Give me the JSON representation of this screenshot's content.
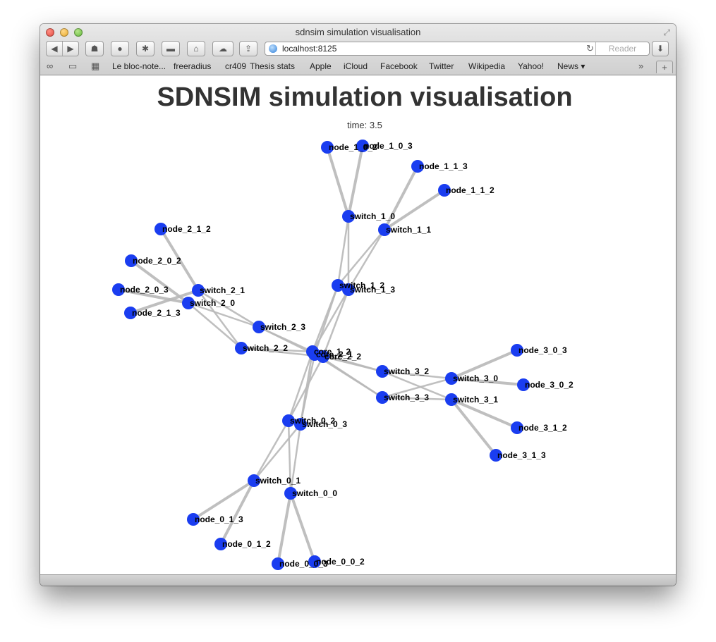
{
  "window": {
    "title": "sdnsim simulation visualisation",
    "url": "localhost:8125",
    "reader_label": "Reader",
    "nav_back_icon": "back-arrow-icon",
    "nav_forward_icon": "forward-arrow-icon"
  },
  "bookmarks": [
    "Le bloc-note...",
    "freeradius",
    "cr409",
    "Thesis stats",
    "Apple",
    "iCloud",
    "Facebook",
    "Twitter",
    "Wikipedia",
    "Yahoo!",
    "News ▾"
  ],
  "page": {
    "title": "SDNSIM simulation visualisation",
    "time_text": "time: 3.5"
  },
  "colors": {
    "node": "#1a3df0",
    "edge": "#b8b8b8"
  },
  "graph": {
    "nodes": [
      {
        "id": "node_1_0_2",
        "label": "node_1_0_2"
      },
      {
        "id": "node_1_0_3",
        "label": "node_1_0_3"
      },
      {
        "id": "node_1_1_3",
        "label": "node_1_1_3"
      },
      {
        "id": "node_1_1_2",
        "label": "node_1_1_2"
      },
      {
        "id": "switch_1_0",
        "label": "switch_1_0"
      },
      {
        "id": "switch_1_1",
        "label": "switch_1_1"
      },
      {
        "id": "switch_1_2",
        "label": "switch_1_2"
      },
      {
        "id": "switch_1_3",
        "label": "switch_1_3"
      },
      {
        "id": "node_2_1_2",
        "label": "node_2_1_2"
      },
      {
        "id": "node_2_0_2",
        "label": "node_2_0_2"
      },
      {
        "id": "node_2_0_3",
        "label": "node_2_0_3"
      },
      {
        "id": "node_2_1_3",
        "label": "node_2_1_3"
      },
      {
        "id": "switch_2_1",
        "label": "switch_2_1"
      },
      {
        "id": "switch_2_0",
        "label": "switch_2_0"
      },
      {
        "id": "switch_2_3",
        "label": "switch_2_3"
      },
      {
        "id": "switch_2_2",
        "label": "switch_2_2"
      },
      {
        "id": "core_1_2",
        "label": "core_1_2"
      },
      {
        "id": "core_2_2",
        "label": "core_2_2"
      },
      {
        "id": "core_2_1",
        "label": "core_2_1"
      },
      {
        "id": "switch_3_2",
        "label": "switch_3_2"
      },
      {
        "id": "switch_3_3",
        "label": "switch_3_3"
      },
      {
        "id": "switch_3_0",
        "label": "switch_3_0"
      },
      {
        "id": "switch_3_1",
        "label": "switch_3_1"
      },
      {
        "id": "node_3_0_3",
        "label": "node_3_0_3"
      },
      {
        "id": "node_3_0_2",
        "label": "node_3_0_2"
      },
      {
        "id": "node_3_1_2",
        "label": "node_3_1_2"
      },
      {
        "id": "node_3_1_3",
        "label": "node_3_1_3"
      },
      {
        "id": "switch_0_2",
        "label": "switch_0_2"
      },
      {
        "id": "switch_0_3",
        "label": "switch_0_3"
      },
      {
        "id": "switch_0_1",
        "label": "switch_0_1"
      },
      {
        "id": "switch_0_0",
        "label": "switch_0_0"
      },
      {
        "id": "node_0_1_3",
        "label": "node_0_1_3"
      },
      {
        "id": "node_0_1_2",
        "label": "node_0_1_2"
      },
      {
        "id": "node_0_0_3",
        "label": "node_0_0_3"
      },
      {
        "id": "node_0_0_2",
        "label": "node_0_0_2"
      }
    ],
    "edges": [
      [
        "node_1_0_2",
        "switch_1_0"
      ],
      [
        "node_1_0_3",
        "switch_1_0"
      ],
      [
        "node_1_1_3",
        "switch_1_1"
      ],
      [
        "node_1_1_2",
        "switch_1_1"
      ],
      [
        "switch_1_0",
        "switch_1_2"
      ],
      [
        "switch_1_0",
        "switch_1_3"
      ],
      [
        "switch_1_1",
        "switch_1_2"
      ],
      [
        "switch_1_1",
        "switch_1_3"
      ],
      [
        "switch_1_2",
        "core_1_2"
      ],
      [
        "switch_1_2",
        "core_2_1"
      ],
      [
        "switch_1_3",
        "core_2_2"
      ],
      [
        "switch_1_3",
        "core_1_2"
      ],
      [
        "node_2_1_2",
        "switch_2_1"
      ],
      [
        "node_2_1_3",
        "switch_2_1"
      ],
      [
        "node_2_0_2",
        "switch_2_0"
      ],
      [
        "node_2_0_3",
        "switch_2_0"
      ],
      [
        "switch_2_0",
        "switch_2_2"
      ],
      [
        "switch_2_0",
        "switch_2_3"
      ],
      [
        "switch_2_1",
        "switch_2_2"
      ],
      [
        "switch_2_1",
        "switch_2_3"
      ],
      [
        "switch_2_2",
        "core_1_2"
      ],
      [
        "switch_2_2",
        "core_2_2"
      ],
      [
        "switch_2_3",
        "core_2_1"
      ],
      [
        "switch_2_3",
        "core_1_2"
      ],
      [
        "switch_3_2",
        "core_1_2"
      ],
      [
        "switch_3_2",
        "core_2_2"
      ],
      [
        "switch_3_3",
        "core_2_1"
      ],
      [
        "switch_3_3",
        "core_1_2"
      ],
      [
        "switch_3_0",
        "switch_3_2"
      ],
      [
        "switch_3_0",
        "switch_3_3"
      ],
      [
        "switch_3_1",
        "switch_3_2"
      ],
      [
        "switch_3_1",
        "switch_3_3"
      ],
      [
        "node_3_0_3",
        "switch_3_0"
      ],
      [
        "node_3_0_2",
        "switch_3_0"
      ],
      [
        "node_3_1_2",
        "switch_3_1"
      ],
      [
        "node_3_1_3",
        "switch_3_1"
      ],
      [
        "switch_0_2",
        "core_1_2"
      ],
      [
        "switch_0_2",
        "core_2_2"
      ],
      [
        "switch_0_3",
        "core_2_1"
      ],
      [
        "switch_0_3",
        "core_1_2"
      ],
      [
        "switch_0_0",
        "switch_0_2"
      ],
      [
        "switch_0_0",
        "switch_0_3"
      ],
      [
        "switch_0_1",
        "switch_0_2"
      ],
      [
        "switch_0_1",
        "switch_0_3"
      ],
      [
        "node_0_1_3",
        "switch_0_1"
      ],
      [
        "node_0_1_2",
        "switch_0_1"
      ],
      [
        "node_0_0_3",
        "switch_0_0"
      ],
      [
        "node_0_0_2",
        "switch_0_0"
      ]
    ]
  }
}
